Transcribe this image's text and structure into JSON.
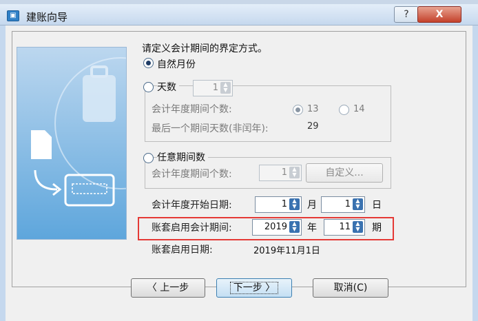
{
  "window": {
    "title": "建账向导",
    "help_label": "?",
    "close_label": "X"
  },
  "heading": "请定义会计期间的界定方式。",
  "options": {
    "natural_month": {
      "label": "自然月份",
      "selected": true
    },
    "days": {
      "label": "天数",
      "value": "1",
      "selected": false
    },
    "custom": {
      "label": "任意期间数",
      "selected": false
    }
  },
  "days_group": {
    "period_count_label": "会计年度期间个数:",
    "opt13": "13",
    "opt14": "14",
    "opt13_selected": true,
    "last_period_label": "最后一个期间天数(非闰年):",
    "last_period_value": "29"
  },
  "custom_group": {
    "period_count_label": "会计年度期间个数:",
    "value": "1",
    "define_button": "自定义..."
  },
  "start_date": {
    "label": "会计年度开始日期:",
    "month": "1",
    "month_unit": "月",
    "day": "1",
    "day_unit": "日"
  },
  "enable_period": {
    "label": "账套启用会计期间:",
    "year": "2019",
    "year_unit": "年",
    "period": "11",
    "period_unit": "期"
  },
  "enable_date": {
    "label": "账套启用日期:",
    "value": "2019年11月1日"
  },
  "buttons": {
    "prev": "〈 上一步",
    "next": "下一步 〉",
    "cancel": "取消(C)"
  }
}
